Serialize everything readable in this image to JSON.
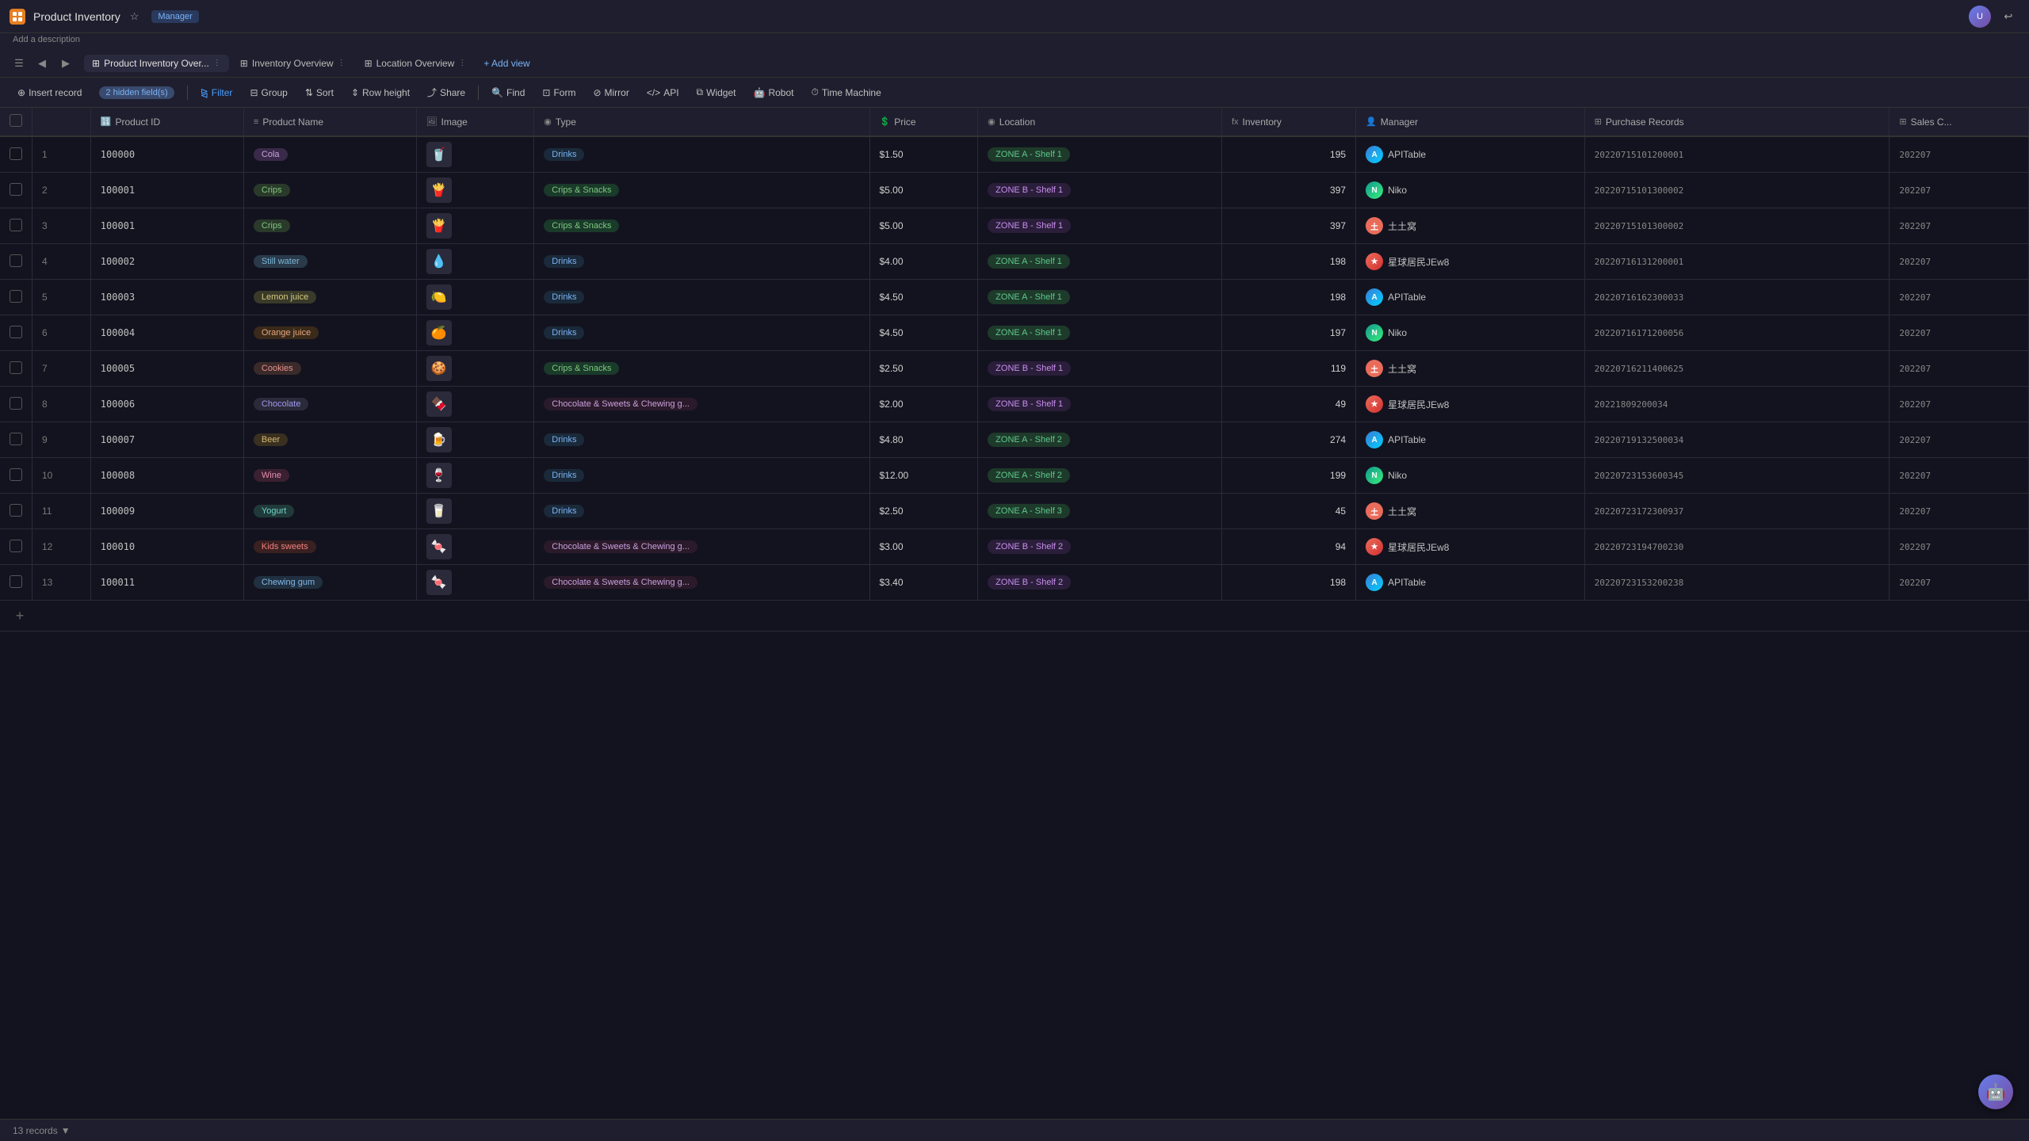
{
  "app": {
    "title": "Product Inventory",
    "subtitle": "Add a description",
    "badge": "Manager"
  },
  "tabs": [
    {
      "id": "product-inventory",
      "label": "Product Inventory Over...",
      "icon": "⊞",
      "active": true
    },
    {
      "id": "inventory-overview",
      "label": "Inventory Overview",
      "icon": "⊞",
      "active": false
    },
    {
      "id": "location-overview",
      "label": "Location Overview",
      "icon": "⊞",
      "active": false
    },
    {
      "id": "add-view",
      "label": "+ Add view",
      "icon": "",
      "active": false
    }
  ],
  "toolbar": {
    "insert_record": "Insert record",
    "hidden_fields": "2 hidden field(s)",
    "filter": "Filter",
    "group": "Group",
    "sort": "Sort",
    "row_height": "Row height",
    "share": "Share",
    "find": "Find",
    "form": "Form",
    "mirror": "Mirror",
    "api": "API",
    "widget": "Widget",
    "robot": "Robot",
    "time_machine": "Time Machine"
  },
  "columns": [
    {
      "id": "row-num",
      "label": "",
      "icon": ""
    },
    {
      "id": "product-id",
      "label": "Product ID",
      "icon": "🔢"
    },
    {
      "id": "product-name",
      "label": "Product Name",
      "icon": "≡"
    },
    {
      "id": "image",
      "label": "Image",
      "icon": "🖼"
    },
    {
      "id": "type",
      "label": "Type",
      "icon": "◉"
    },
    {
      "id": "price",
      "label": "Price",
      "icon": "💲"
    },
    {
      "id": "location",
      "label": "Location",
      "icon": "◉"
    },
    {
      "id": "inventory",
      "label": "Inventory",
      "icon": "fx"
    },
    {
      "id": "manager",
      "label": "Manager",
      "icon": "👤"
    },
    {
      "id": "purchase-records",
      "label": "Purchase Records",
      "icon": "⊞"
    },
    {
      "id": "sales",
      "label": "Sales C...",
      "icon": "⊞"
    }
  ],
  "rows": [
    {
      "num": 1,
      "product_id": "100000",
      "product_name": "Cola",
      "name_chip": "chip-cola",
      "image_emoji": "🥤",
      "type": "Drinks",
      "type_class": "type-drinks",
      "price": "$1.50",
      "location": "ZONE A - Shelf 1",
      "loc_class": "loc-badge",
      "inventory": 195,
      "manager": "APITable",
      "manager_class": "mgr-apitable",
      "manager_icon": "A",
      "purchase_id": "20220715101200001",
      "sales": "202207"
    },
    {
      "num": 2,
      "product_id": "100001",
      "product_name": "Crips",
      "name_chip": "chip-crips",
      "image_emoji": "🍟",
      "type": "Crips & Snacks",
      "type_class": "type-crips",
      "price": "$5.00",
      "location": "ZONE B - Shelf 1",
      "loc_class": "loc-badge loc-zone-b",
      "inventory": 397,
      "manager": "Niko",
      "manager_class": "mgr-niko",
      "manager_icon": "N",
      "purchase_id": "20220715101300002",
      "sales": "202207"
    },
    {
      "num": 3,
      "product_id": "100001",
      "product_name": "Crips",
      "name_chip": "chip-crips",
      "image_emoji": "🍟",
      "type": "Crips & Snacks",
      "type_class": "type-crips",
      "price": "$5.00",
      "location": "ZONE B - Shelf 1",
      "loc_class": "loc-badge loc-zone-b",
      "inventory": 397,
      "manager": "土土窝",
      "manager_class": "mgr-tnt",
      "manager_icon": "土",
      "purchase_id": "20220715101300002",
      "sales": "202207"
    },
    {
      "num": 4,
      "product_id": "100002",
      "product_name": "Still water",
      "name_chip": "chip-stillwater",
      "image_emoji": "💧",
      "type": "Drinks",
      "type_class": "type-drinks",
      "price": "$4.00",
      "location": "ZONE A - Shelf 1",
      "loc_class": "loc-badge",
      "inventory": 198,
      "manager": "星球居民JEw8",
      "manager_class": "mgr-star",
      "manager_icon": "★",
      "purchase_id": "20220716131200001",
      "sales": "202207"
    },
    {
      "num": 5,
      "product_id": "100003",
      "product_name": "Lemon juice",
      "name_chip": "chip-lemon",
      "image_emoji": "🍋",
      "type": "Drinks",
      "type_class": "type-drinks",
      "price": "$4.50",
      "location": "ZONE A - Shelf 1",
      "loc_class": "loc-badge",
      "inventory": 198,
      "manager": "APITable",
      "manager_class": "mgr-apitable",
      "manager_icon": "A",
      "purchase_id": "20220716162300033",
      "sales": "202207"
    },
    {
      "num": 6,
      "product_id": "100004",
      "product_name": "Orange juice",
      "name_chip": "chip-orange",
      "image_emoji": "🍊",
      "type": "Drinks",
      "type_class": "type-drinks",
      "price": "$4.50",
      "location": "ZONE A - Shelf 1",
      "loc_class": "loc-badge",
      "inventory": 197,
      "manager": "Niko",
      "manager_class": "mgr-niko",
      "manager_icon": "N",
      "purchase_id": "20220716171200056",
      "sales": "202207"
    },
    {
      "num": 7,
      "product_id": "100005",
      "product_name": "Cookies",
      "name_chip": "chip-cookies",
      "image_emoji": "🍪",
      "type": "Crips & Snacks",
      "type_class": "type-crips",
      "price": "$2.50",
      "location": "ZONE B - Shelf 1",
      "loc_class": "loc-badge loc-zone-b",
      "inventory": 119,
      "manager": "土土窝",
      "manager_class": "mgr-tnt",
      "manager_icon": "土",
      "purchase_id": "20220716211400625",
      "sales": "202207"
    },
    {
      "num": 8,
      "product_id": "100006",
      "product_name": "Chocolate",
      "name_chip": "chip-chocolate",
      "image_emoji": "🍫",
      "type": "Chocolate & Sweets & Chewing g...",
      "type_class": "type-choco",
      "price": "$2.00",
      "location": "ZONE B - Shelf 1",
      "loc_class": "loc-badge loc-zone-b",
      "inventory": 49,
      "manager": "星球居民JEw8",
      "manager_class": "mgr-star",
      "manager_icon": "★",
      "purchase_id": "20221809200034",
      "sales": "202207"
    },
    {
      "num": 9,
      "product_id": "100007",
      "product_name": "Beer",
      "name_chip": "chip-beer",
      "image_emoji": "🍺",
      "type": "Drinks",
      "type_class": "type-drinks",
      "price": "$4.80",
      "location": "ZONE A - Shelf 2",
      "loc_class": "loc-badge",
      "inventory": 274,
      "manager": "APITable",
      "manager_class": "mgr-apitable",
      "manager_icon": "A",
      "purchase_id": "20220719132500034",
      "sales": "202207"
    },
    {
      "num": 10,
      "product_id": "100008",
      "product_name": "Wine",
      "name_chip": "chip-wine",
      "image_emoji": "🍷",
      "type": "Drinks",
      "type_class": "type-drinks",
      "price": "$12.00",
      "location": "ZONE A - Shelf 2",
      "loc_class": "loc-badge",
      "inventory": 199,
      "manager": "Niko",
      "manager_class": "mgr-niko",
      "manager_icon": "N",
      "purchase_id": "20220723153600345",
      "sales": "202207"
    },
    {
      "num": 11,
      "product_id": "100009",
      "product_name": "Yogurt",
      "name_chip": "chip-yogurt",
      "image_emoji": "🥛",
      "type": "Drinks",
      "type_class": "type-drinks",
      "price": "$2.50",
      "location": "ZONE A - Shelf 3",
      "loc_class": "loc-badge",
      "inventory": 45,
      "manager": "土土窝",
      "manager_class": "mgr-tnt",
      "manager_icon": "土",
      "purchase_id": "20220723172300937",
      "sales": "202207"
    },
    {
      "num": 12,
      "product_id": "100010",
      "product_name": "Kids sweets",
      "name_chip": "chip-kidssweets",
      "image_emoji": "🍬",
      "type": "Chocolate & Sweets & Chewing g...",
      "type_class": "type-choco",
      "price": "$3.00",
      "location": "ZONE B - Shelf 2",
      "loc_class": "loc-badge loc-zone-b",
      "inventory": 94,
      "manager": "星球居民JEw8",
      "manager_class": "mgr-star",
      "manager_icon": "★",
      "purchase_id": "20220723194700230",
      "sales": "202207"
    },
    {
      "num": 13,
      "product_id": "100011",
      "product_name": "Chewing gum",
      "name_chip": "chip-chewinggum",
      "image_emoji": "🍬",
      "type": "Chocolate & Sweets & Chewing g...",
      "type_class": "type-choco",
      "price": "$3.40",
      "location": "ZONE B - Shelf 2",
      "loc_class": "loc-badge loc-zone-b",
      "inventory": 198,
      "manager": "APITable",
      "manager_class": "mgr-apitable",
      "manager_icon": "A",
      "purchase_id": "20220723153200238",
      "sales": "202207"
    }
  ],
  "footer": {
    "records_count": "13 records",
    "records_icon": "▼"
  }
}
